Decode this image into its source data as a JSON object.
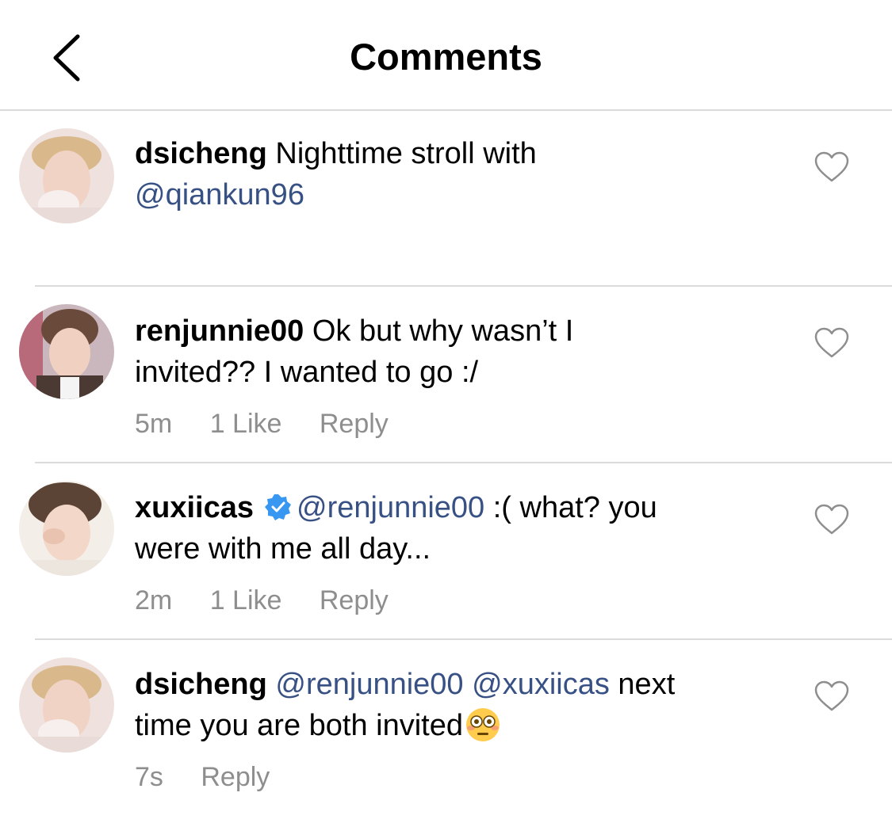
{
  "header": {
    "title": "Comments"
  },
  "icons": {
    "back": "chevron-left-icon",
    "like": "heart-outline-icon",
    "verified": "verified-badge-icon",
    "emoji": "flushed-face-emoji"
  },
  "colors": {
    "mention": "#385185",
    "meta": "#8e8e8e",
    "verified": "#3897f0",
    "divider": "#dbdbdb"
  },
  "comments": [
    {
      "username": "dsicheng",
      "text_line1": "Nighttime stroll with",
      "mention": "@qiankun96"
    },
    {
      "username": "renjunnie00",
      "text_line1": "Ok but why wasn’t I",
      "text_line2": "invited?? I wanted to go :/",
      "time": "5m",
      "likes": "1 Like",
      "reply": "Reply"
    },
    {
      "username": "xuxiicas",
      "verified": true,
      "mention": "@renjunnie00",
      "text_line1": ":( what? you",
      "text_line2": "were with me all day...",
      "time": "2m",
      "likes": "1 Like",
      "reply": "Reply"
    },
    {
      "username": "dsicheng",
      "mention1": "@renjunnie00",
      "mention2": "@xuxiicas",
      "text_line1": "next",
      "text_line2": "time you are both invited",
      "time": "7s",
      "reply": "Reply"
    }
  ]
}
